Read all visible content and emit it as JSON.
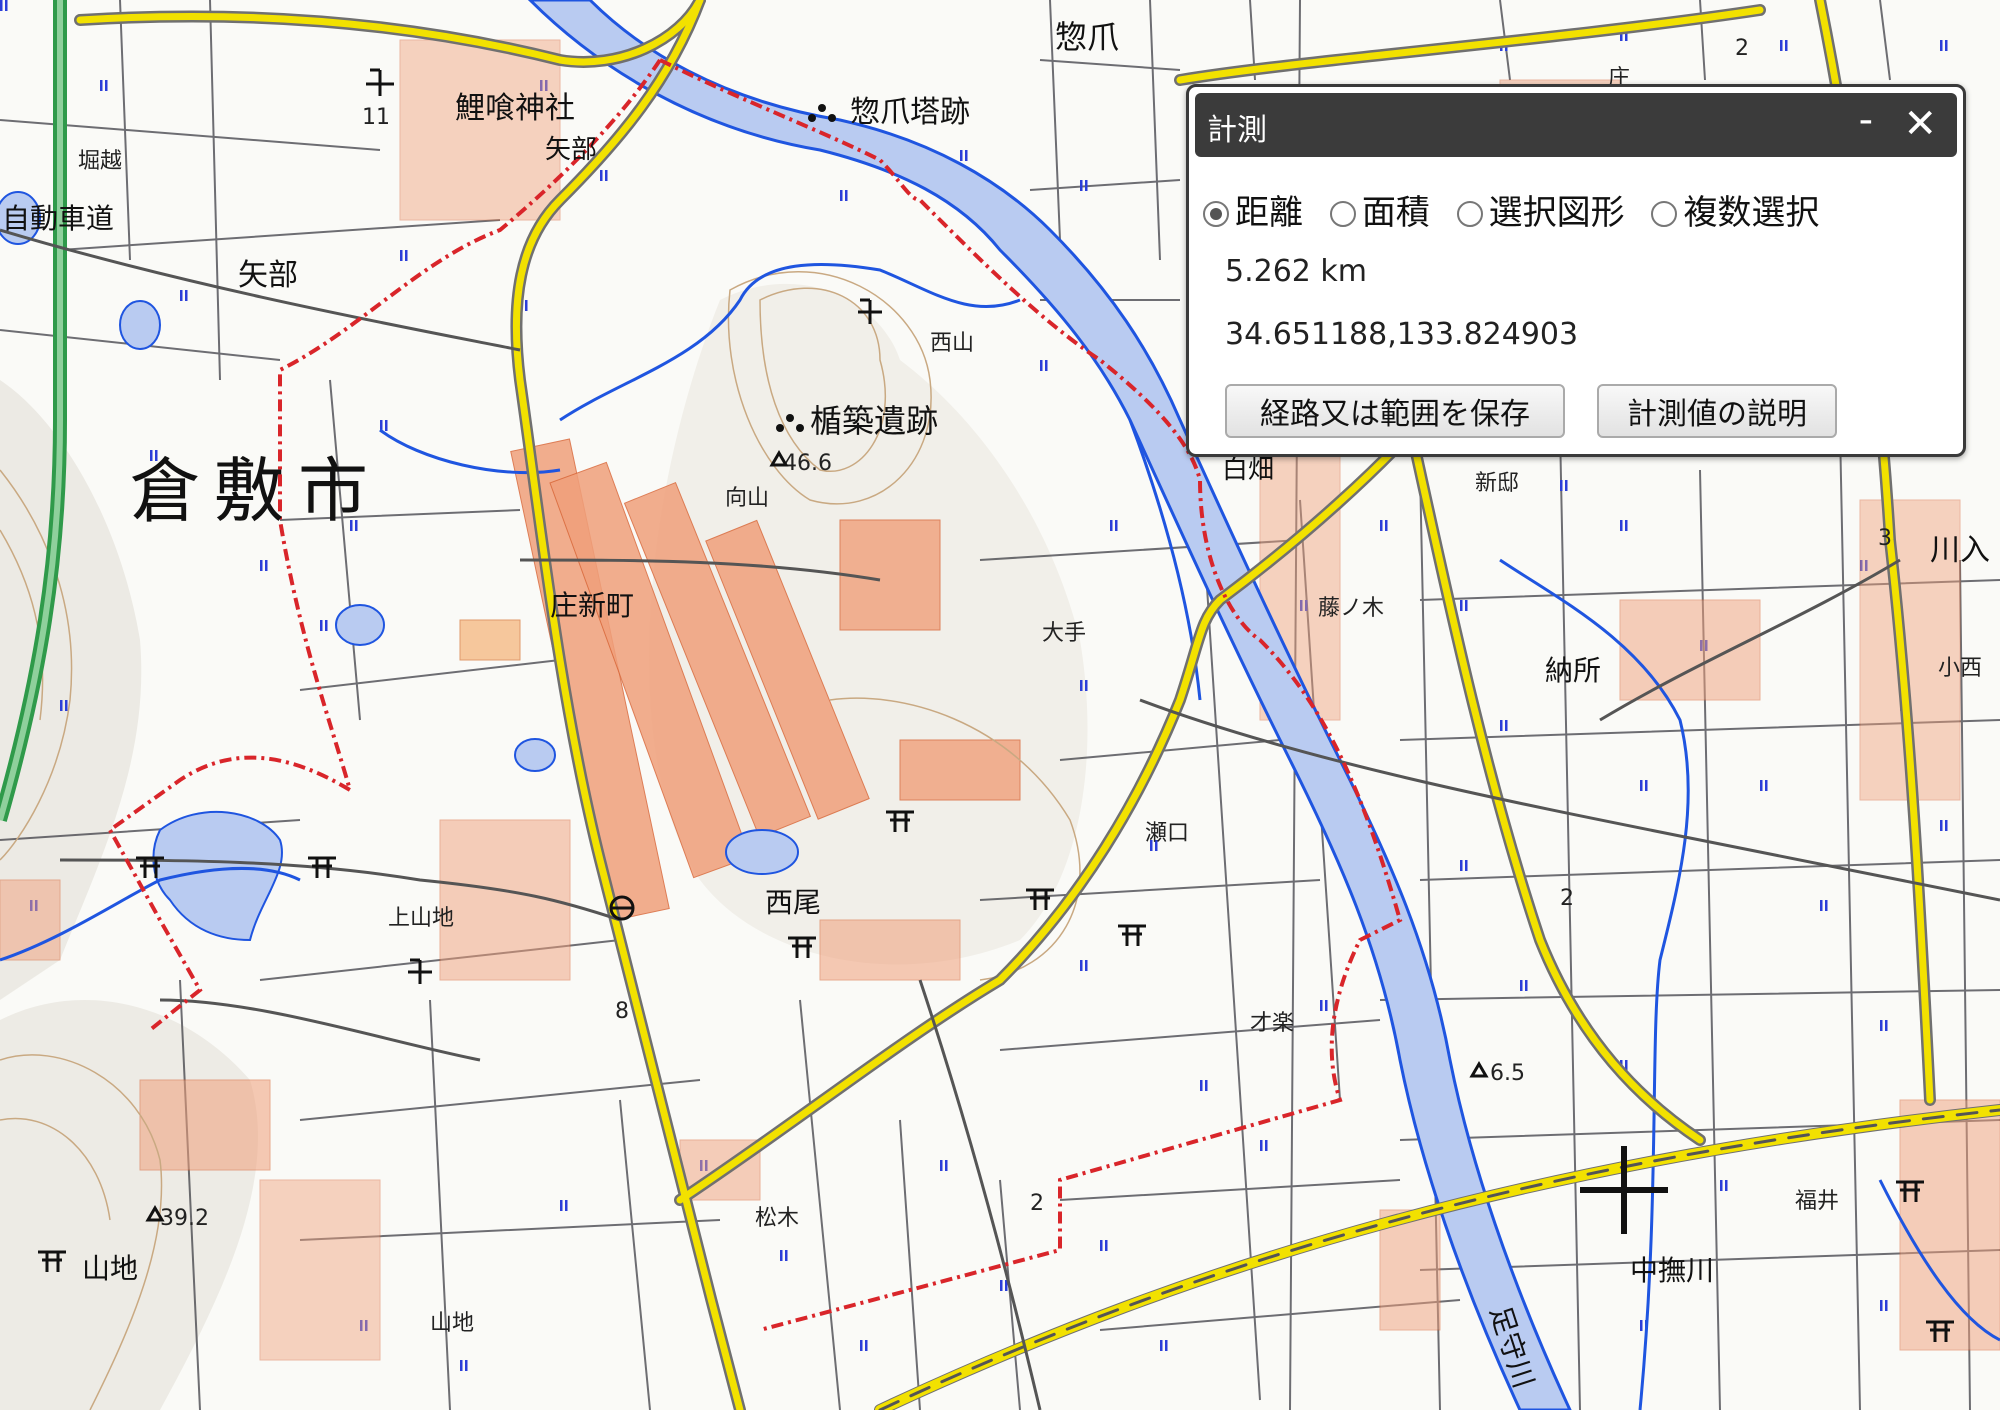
{
  "map": {
    "city_label": "倉敷市",
    "place_labels": [
      "惣爪",
      "鯉喰神社",
      "惣爪塔跡",
      "矢部",
      "矢部",
      "堀越",
      "楯築遺跡",
      "西山",
      "向山",
      "庄新町",
      "大手",
      "西尾",
      "上山地",
      "山地",
      "山地",
      "松木",
      "瀬口",
      "才楽",
      "藤ノ木",
      "納所",
      "新邸",
      "白畑",
      "川入",
      "小西",
      "福井",
      "足守川",
      "中撫川",
      "自動車道",
      "庄"
    ],
    "spot_heights": [
      "46.6",
      "39.2",
      "6.5"
    ],
    "route_numbers": [
      "2",
      "3",
      "8",
      "2",
      "11",
      "2"
    ],
    "colors": {
      "river": "#b9cbf1",
      "river_edge": "#1f55e0",
      "road_yellow": "#f2e100",
      "boundary": "#d9252a",
      "buildings": "#f0a07b",
      "expressway": "#2f9a4a",
      "contour": "#c9a982"
    },
    "icons": [
      "shrine-icon",
      "temple-icon",
      "ruins-icon",
      "police-icon",
      "crosshair-icon"
    ]
  },
  "panel": {
    "title": "計測",
    "minimize": "-",
    "close": "✕",
    "modes": [
      {
        "label": "距離",
        "selected": true
      },
      {
        "label": "面積",
        "selected": false
      },
      {
        "label": "選択図形",
        "selected": false
      },
      {
        "label": "複数選択",
        "selected": false
      }
    ],
    "distance": "5.262 km",
    "coordinates": "34.651188,133.824903",
    "save_button": "経路又は範囲を保存",
    "help_button": "計測値の説明"
  }
}
